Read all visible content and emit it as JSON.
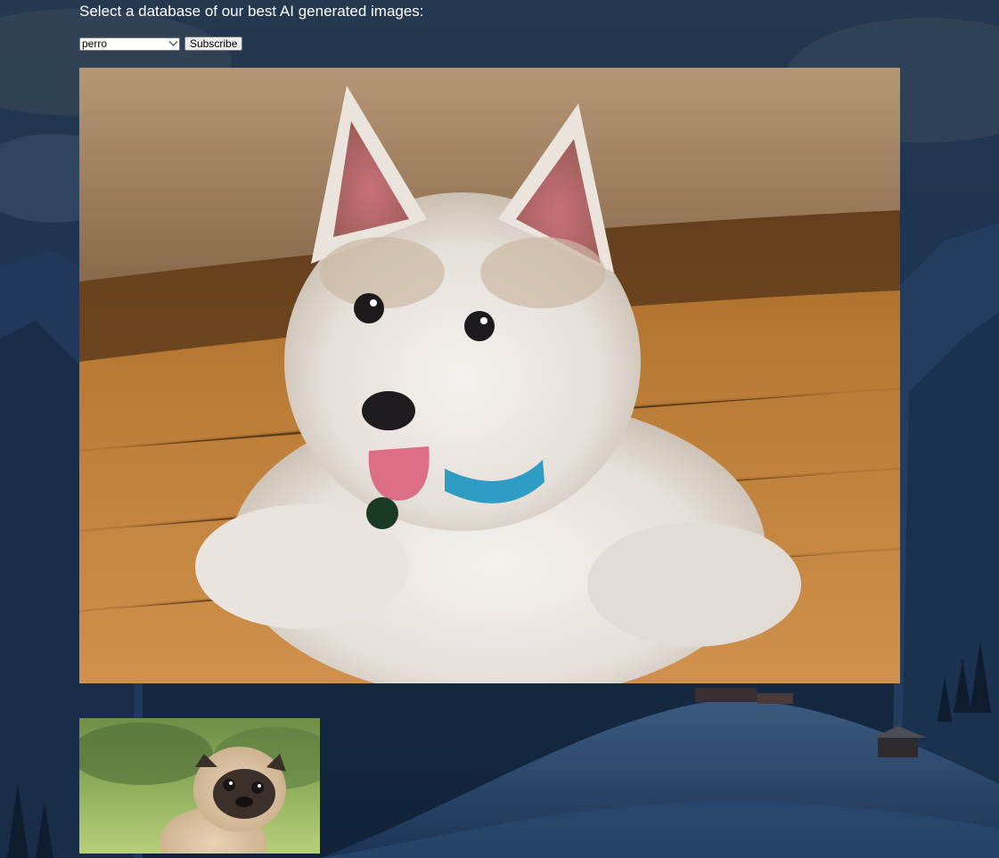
{
  "page": {
    "heading": "Select a database of our best AI generated images:"
  },
  "form": {
    "select": {
      "selected": "perro"
    },
    "subscribe_label": "Subscribe"
  },
  "images": {
    "hero": "husky puppy lying on wooden floor with blue collar",
    "thumbnail": "pug puppy on green blurred background"
  },
  "colors": {
    "background": "#17283e",
    "text": "#ffffff"
  }
}
